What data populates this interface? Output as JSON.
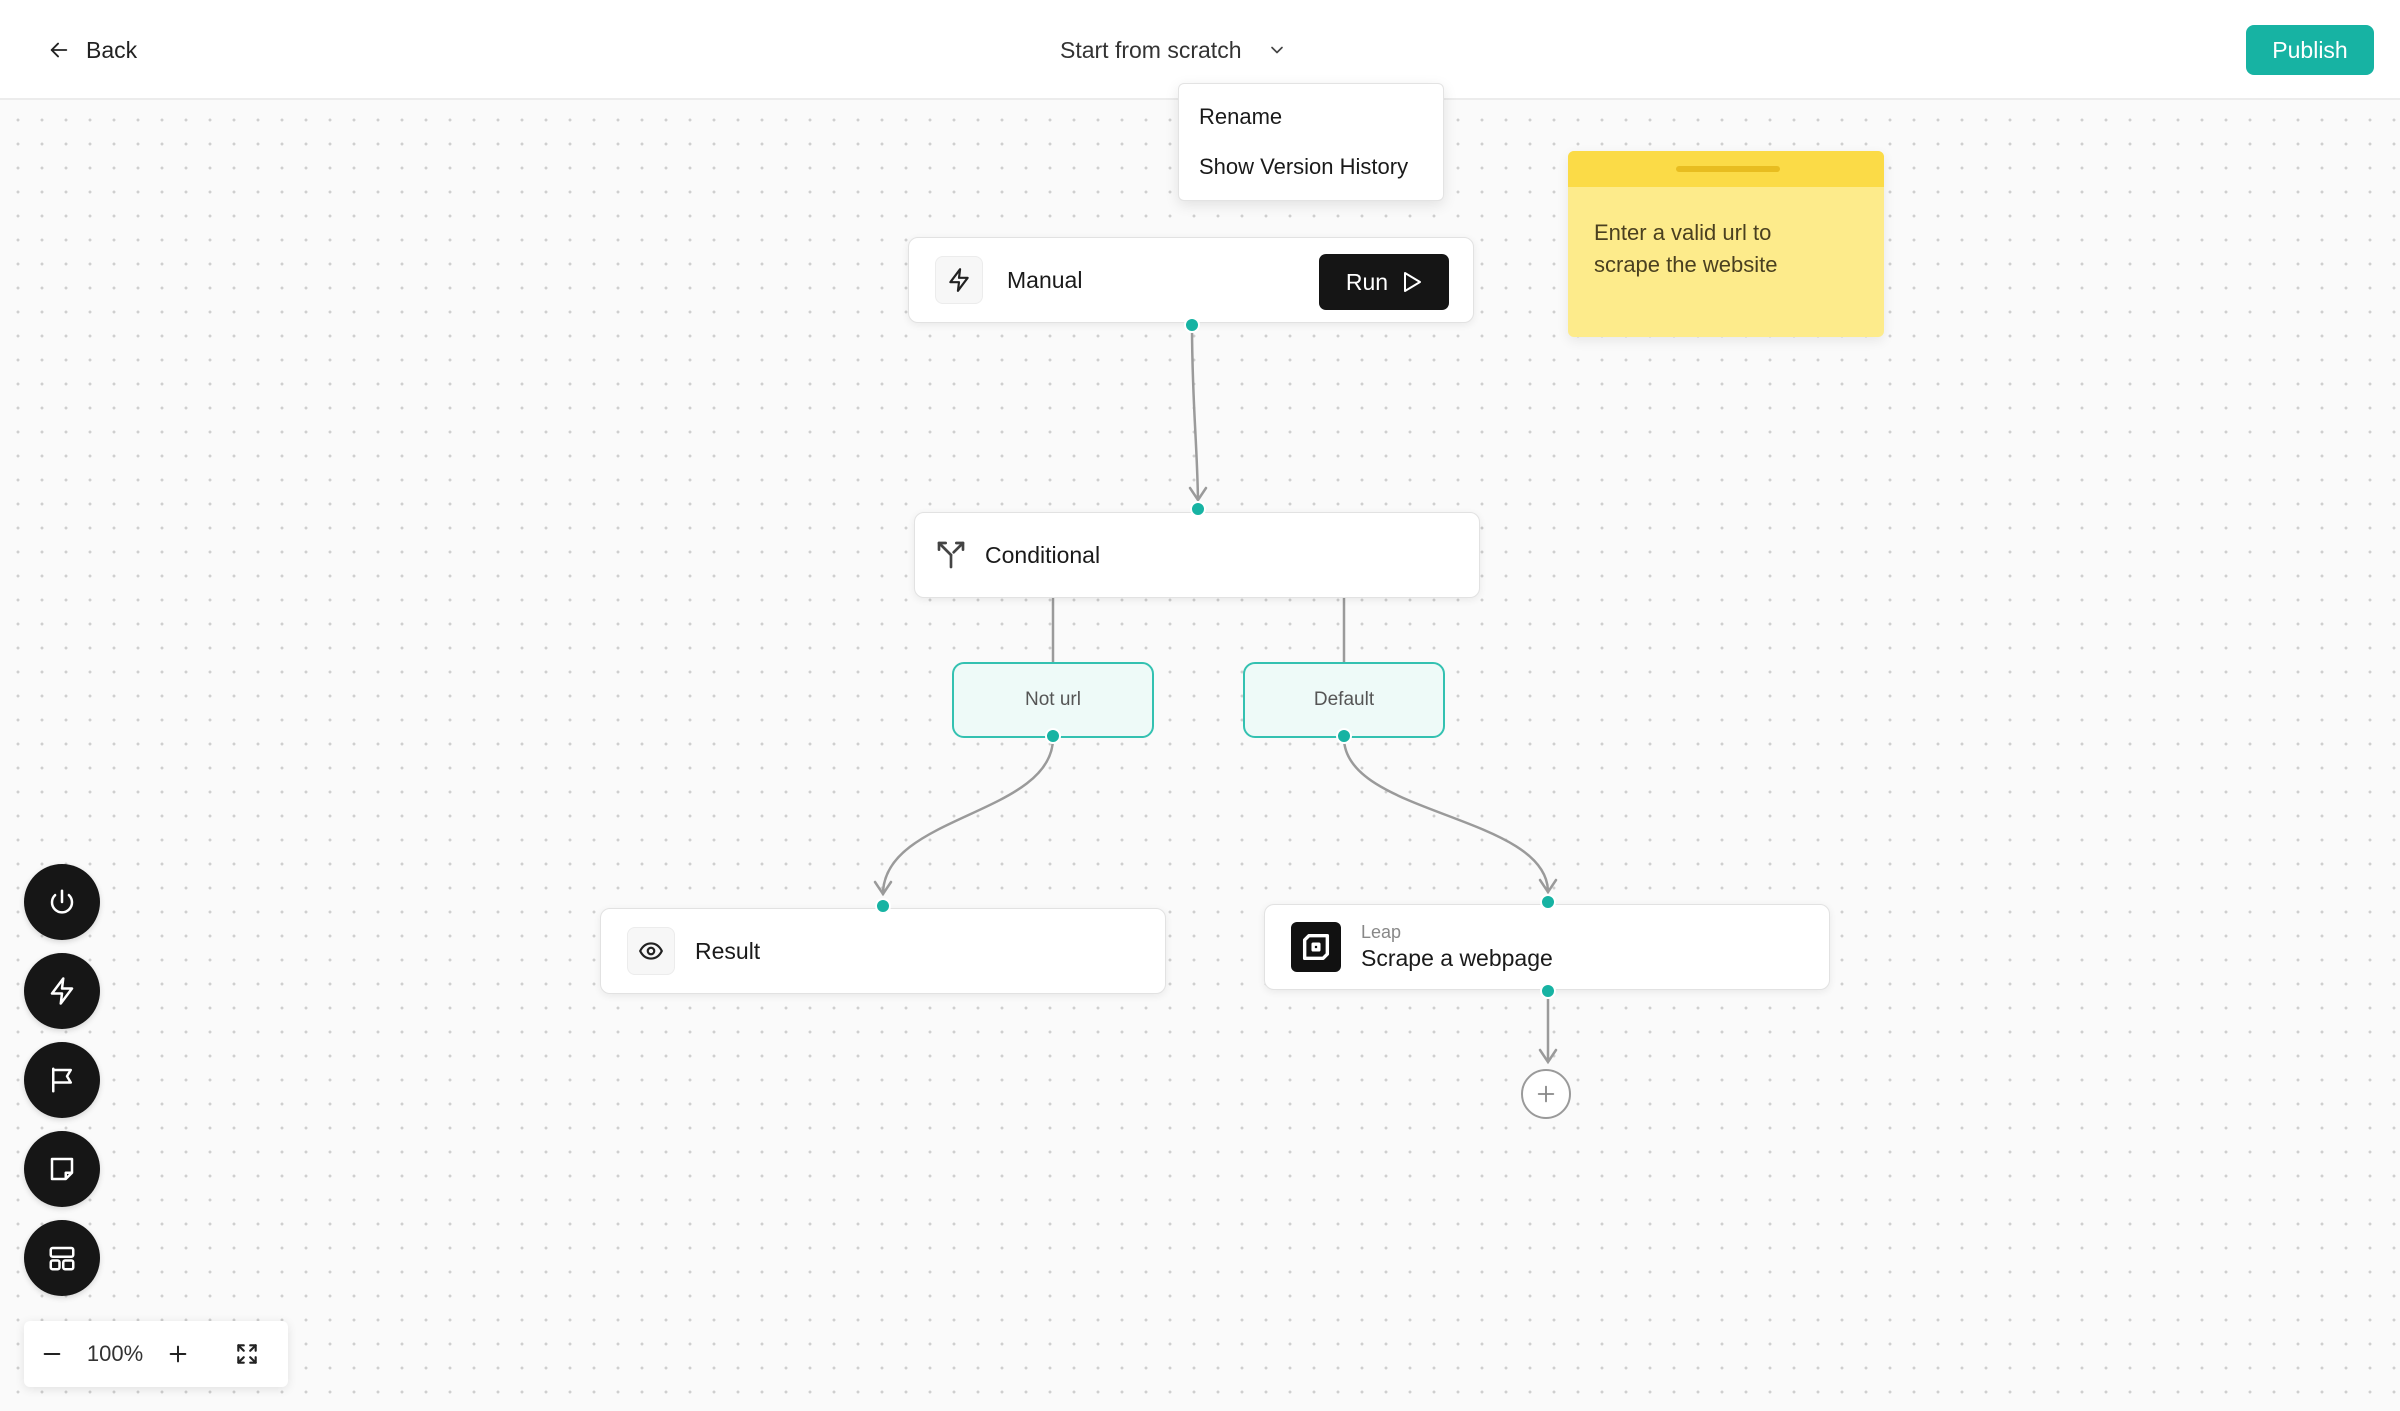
{
  "header": {
    "back_label": "Back",
    "workflow_title": "Start from scratch",
    "publish_label": "Publish"
  },
  "title_menu": {
    "items": [
      {
        "label": "Rename"
      },
      {
        "label": "Show Version History"
      }
    ]
  },
  "sticky_note": {
    "text_line1": "Enter a valid url to",
    "text_line2": "scrape the website"
  },
  "nodes": {
    "manual": {
      "label": "Manual",
      "run_label": "Run",
      "icon": "lightning-icon"
    },
    "conditional": {
      "label": "Conditional",
      "icon": "split-arrows-icon"
    },
    "branches": [
      {
        "label": "Not url"
      },
      {
        "label": "Default"
      }
    ],
    "result": {
      "label": "Result",
      "icon": "eye-icon"
    },
    "scrape": {
      "provider": "Leap",
      "label": "Scrape a webpage",
      "icon": "leap-logo-icon"
    }
  },
  "toolbar": {
    "items": [
      {
        "icon": "power-icon"
      },
      {
        "icon": "lightning-icon"
      },
      {
        "icon": "flag-icon"
      },
      {
        "icon": "note-icon"
      },
      {
        "icon": "layout-icon"
      }
    ]
  },
  "zoom": {
    "level": "100%"
  },
  "colors": {
    "accent": "#17b3a3",
    "note": "#fdeb8b",
    "note_header": "#fbdb47",
    "dark_button": "#151515"
  }
}
